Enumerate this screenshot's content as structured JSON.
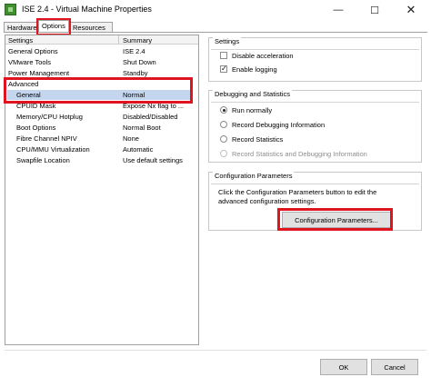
{
  "window": {
    "title": "ISE 2.4 - Virtual Machine Properties",
    "minimize_glyph": "—",
    "maximize_glyph": "☐",
    "close_glyph": "✕"
  },
  "tabs": [
    {
      "label": "Hardware"
    },
    {
      "label": "Options"
    },
    {
      "label": "Resources"
    }
  ],
  "list": {
    "headers": {
      "settings": "Settings",
      "summary": "Summary"
    },
    "rows": [
      {
        "setting": "General Options",
        "summary": "ISE 2.4"
      },
      {
        "setting": "VMware Tools",
        "summary": "Shut Down"
      },
      {
        "setting": "Power Management",
        "summary": "Standby"
      },
      {
        "setting": "Advanced",
        "summary": ""
      },
      {
        "setting": "General",
        "summary": "Normal"
      },
      {
        "setting": "CPUID Mask",
        "summary": "Expose Nx flag to ..."
      },
      {
        "setting": "Memory/CPU Hotplug",
        "summary": "Disabled/Disabled"
      },
      {
        "setting": "Boot Options",
        "summary": "Normal Boot"
      },
      {
        "setting": "Fibre Channel NPIV",
        "summary": "None"
      },
      {
        "setting": "CPU/MMU Virtualization",
        "summary": "Automatic"
      },
      {
        "setting": "Swapfile Location",
        "summary": "Use default settings"
      }
    ]
  },
  "settings_group": {
    "title": "Settings",
    "disable_acceleration": {
      "label": "Disable acceleration",
      "checked": false
    },
    "enable_logging": {
      "label": "Enable logging",
      "checked": true
    }
  },
  "debug_group": {
    "title": "Debugging and Statistics",
    "options": [
      {
        "label": "Run normally",
        "selected": true,
        "enabled": true
      },
      {
        "label": "Record Debugging Information",
        "selected": false,
        "enabled": true
      },
      {
        "label": "Record Statistics",
        "selected": false,
        "enabled": true
      },
      {
        "label": "Record Statistics and Debugging Information",
        "selected": false,
        "enabled": false
      }
    ]
  },
  "config_group": {
    "title": "Configuration Parameters",
    "description": "Click the Configuration Parameters button to edit the advanced configuration settings.",
    "button_label": "Configuration Parameters..."
  },
  "footer": {
    "ok_label": "OK",
    "cancel_label": "Cancel"
  },
  "colors": {
    "highlight": "#e0141e",
    "selection": "#c4d6ee"
  }
}
